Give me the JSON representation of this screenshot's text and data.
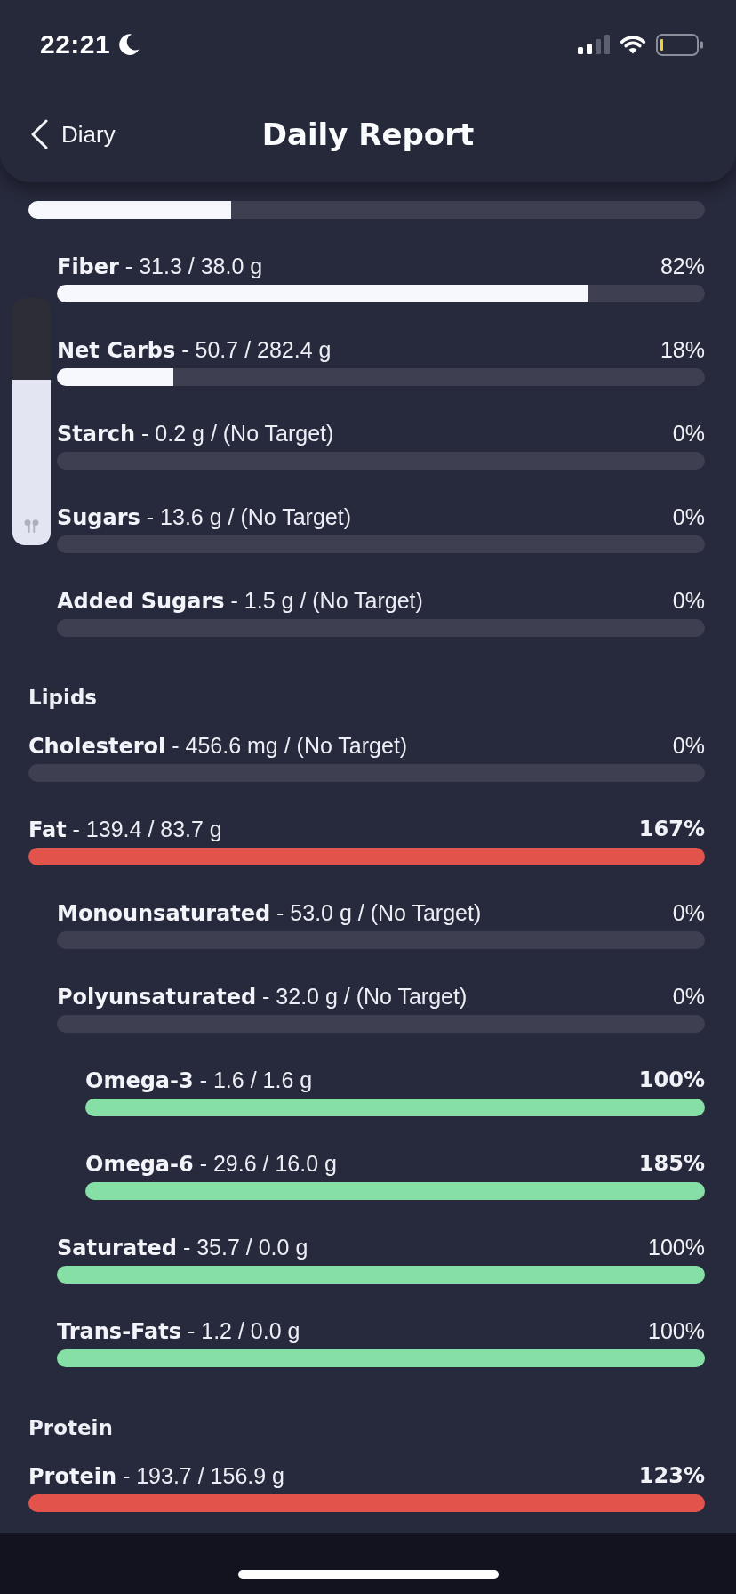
{
  "status_bar": {
    "time": "22:21"
  },
  "header": {
    "back_label": "Diary",
    "title": "Daily Report"
  },
  "sections": [
    {
      "rows": [
        {
          "level": 0.3,
          "color": "#f7f8fd",
          "children": [
            {
              "label": "**Fiber** - 31.3 / 38.0 g",
              "percent": "82%",
              "emphasized": false,
              "level": 0.82,
              "color": "#f7f8fd"
            },
            {
              "label": "**Net Carbs** - 50.7 / 282.4 g",
              "percent": "18%",
              "emphasized": false,
              "level": 0.18,
              "color": "#f7f8fd"
            },
            {
              "label": "**Starch** - 0.2 g / (No Target)",
              "percent": "0%",
              "emphasized": false,
              "level": 0
            },
            {
              "label": "**Sugars** - 13.6 g / (No Target)",
              "percent": "0%",
              "emphasized": false,
              "level": 0
            },
            {
              "label": "**Added Sugars** - 1.5 g / (No Target)",
              "percent": "0%",
              "emphasized": false,
              "level": 0
            }
          ]
        }
      ]
    },
    {
      "heading": "Lipids",
      "rows": [
        {
          "label": "**Cholesterol** - 456.6 mg / (No Target)",
          "percent": "0%",
          "emphasized": false,
          "level": 0
        },
        {
          "label": "**Fat** - 139.4 / 83.7 g",
          "percent": "167%",
          "emphasized": true,
          "level": 1,
          "color": "#e2534c",
          "children": [
            {
              "label": "**Monounsaturated** - 53.0 g / (No Target)",
              "percent": "0%",
              "emphasized": false,
              "level": 0
            },
            {
              "label": "**Polyunsaturated** - 32.0 g / (No Target)",
              "percent": "0%",
              "emphasized": false,
              "level": 0,
              "children": [
                {
                  "label": "**Omega-3** - 1.6 / 1.6 g",
                  "percent": "100%",
                  "emphasized": true,
                  "level": 1,
                  "color": "#86dfa4"
                },
                {
                  "label": "**Omega-6** - 29.6 / 16.0 g",
                  "percent": "185%",
                  "emphasized": true,
                  "level": 1,
                  "color": "#86dfa4"
                }
              ]
            },
            {
              "label": "**Saturated** - 35.7 / 0.0 g",
              "percent": "100%",
              "emphasized": false,
              "level": 1,
              "color": "#86dfa4"
            },
            {
              "label": "**Trans-Fats** - 1.2 / 0.0 g",
              "percent": "100%",
              "emphasized": false,
              "level": 1,
              "color": "#86dfa4"
            }
          ]
        }
      ]
    },
    {
      "heading": "Protein",
      "rows": [
        {
          "label": "**Protein** - 193.7 / 156.9 g",
          "percent": "123%",
          "emphasized": true,
          "level": 1,
          "color": "#e2534c"
        }
      ]
    }
  ],
  "volume_hud": {
    "level": 0.67
  }
}
